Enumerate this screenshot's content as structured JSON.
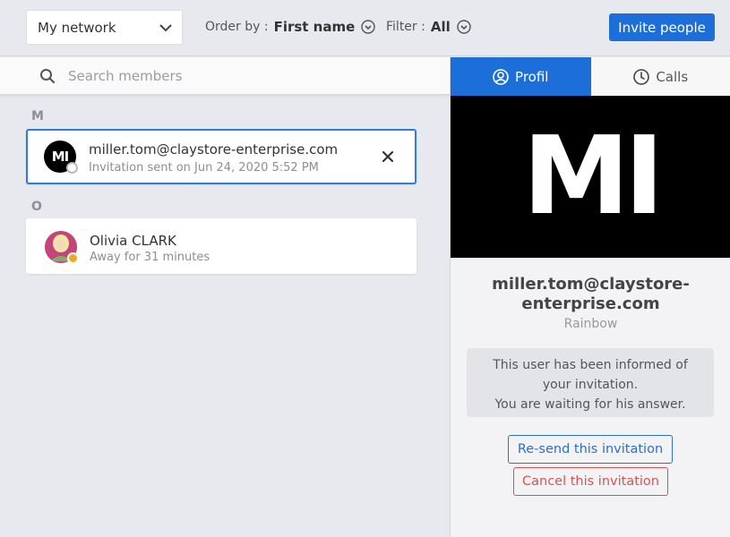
{
  "toolbar": {
    "network_select": "My network",
    "order_label": "Order by :",
    "order_value": "First name",
    "filter_label": "Filter :",
    "filter_value": "All",
    "invite_label": "Invite people"
  },
  "search": {
    "placeholder": "Search members"
  },
  "groups": [
    {
      "letter": "M",
      "contact": {
        "initials": "MI",
        "name": "miller.tom@claystore-enterprise.com",
        "status": "Invitation sent on Jun 24, 2020 5:52 PM",
        "status_color": "#ffffff"
      }
    },
    {
      "letter": "O",
      "contact": {
        "name": "Olivia CLARK",
        "status": "Away for 31 minutes",
        "status_color": "#f5a623"
      }
    }
  ],
  "details": {
    "tabs": {
      "profil": "Profil",
      "calls": "Calls"
    },
    "initials": "MI",
    "name_line1": "miller.tom@claystore-",
    "name_line2": "enterprise.com",
    "company": "Rainbow",
    "info_line1": "This user has been informed of",
    "info_line2": "your invitation.",
    "info_line3": "You are waiting for his answer.",
    "resend_label": "Re-send this invitation",
    "cancel_label": "Cancel this invitation"
  },
  "colors": {
    "accent": "#1c6fd8",
    "danger": "#d9534f",
    "away": "#f5a623"
  }
}
